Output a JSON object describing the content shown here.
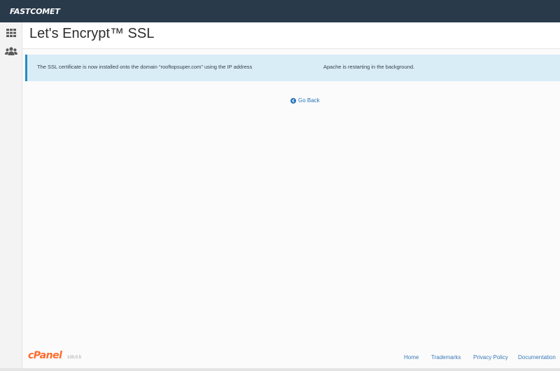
{
  "header": {
    "brand": "FASTCOMET",
    "background": "#293a4a"
  },
  "sidebar": {
    "items": [
      {
        "icon": "grid-icon",
        "label": ""
      },
      {
        "icon": "users-icon",
        "label": ""
      }
    ]
  },
  "page": {
    "title": "Let's Encrypt™ SSL"
  },
  "alert": {
    "message": "The SSL certificate is now installed onto the domain “rooftopsuper.com” using the IP address",
    "message_tail": "Apache is restarting in the background.",
    "accent": "#2b8ac2",
    "background": "#d9edf7"
  },
  "actions": {
    "go_back_icon": "arrow-circle-left-icon",
    "go_back_label": "Go Back"
  },
  "footer": {
    "logo": "cPanel",
    "version": "100.0.5",
    "links": [
      "Home",
      "Trademarks",
      "Privacy Policy",
      "Documentation"
    ],
    "logo_color": "#ff6c2c",
    "link_color": "#3a7ab8"
  }
}
